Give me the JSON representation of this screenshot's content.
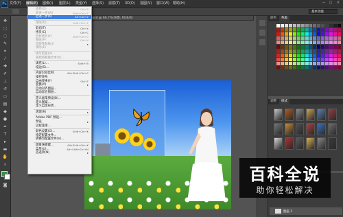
{
  "app": {
    "logo": "Ps"
  },
  "menubar": {
    "items": [
      {
        "label": "文件(F)"
      },
      {
        "label": "编辑(E)"
      },
      {
        "label": "图像(I)"
      },
      {
        "label": "图层(L)"
      },
      {
        "label": "类型(Y)"
      },
      {
        "label": "选择(S)"
      },
      {
        "label": "滤镜(T)"
      },
      {
        "label": "3D(D)"
      },
      {
        "label": "视图(V)"
      },
      {
        "label": "窗口(W)"
      },
      {
        "label": "帮助(H)"
      }
    ],
    "window_controls": [
      "—",
      "□",
      "×"
    ]
  },
  "options_bar": {
    "workspace": "基本功能"
  },
  "document": {
    "tab_title": "背景.psd @ 66.7%(背景, RGB/8)"
  },
  "edit_menu": {
    "items": [
      {
        "label": "还原(O)",
        "shortcut": "Ctrl+Z",
        "disabled": true
      },
      {
        "label": "前进一步(W)",
        "shortcut": "Shift+Ctrl+Z",
        "disabled": true
      },
      {
        "label": "后退一步(K)",
        "shortcut": "Alt+Ctrl+Z",
        "highlighted": true
      },
      {
        "sep": true
      },
      {
        "label": "渐隐(D)...",
        "shortcut": "Shift+Ctrl+F",
        "disabled": true
      },
      {
        "sep": true
      },
      {
        "label": "剪切(T)",
        "shortcut": "Ctrl+X"
      },
      {
        "label": "拷贝(C)",
        "shortcut": "Ctrl+C"
      },
      {
        "label": "合并拷贝(Y)",
        "shortcut": "Shift+Ctrl+C",
        "disabled": true
      },
      {
        "label": "粘贴(P)",
        "shortcut": "Ctrl+V",
        "disabled": true
      },
      {
        "label": "选择性粘贴(I)",
        "submenu": true,
        "disabled": true
      },
      {
        "label": "清除(E)",
        "disabled": true
      },
      {
        "sep": true
      },
      {
        "label": "拼写检查(H)...",
        "disabled": true
      },
      {
        "label": "查找和替换文本(X)...",
        "disabled": true
      },
      {
        "sep": true
      },
      {
        "label": "填充(L)...",
        "shortcut": "Shift+F5"
      },
      {
        "label": "描边(S)..."
      },
      {
        "sep": true
      },
      {
        "label": "内容识别比例",
        "shortcut": "Alt+Shift+Ctrl+C"
      },
      {
        "label": "操控变形"
      },
      {
        "label": "自由变换(F)",
        "shortcut": "Ctrl+T"
      },
      {
        "label": "变换(A)",
        "submenu": true
      },
      {
        "label": "自动对齐图层..."
      },
      {
        "label": "自动混合图层..."
      },
      {
        "sep": true
      },
      {
        "label": "定义画笔预设(B)..."
      },
      {
        "label": "定义图案..."
      },
      {
        "label": "定义自定形状..."
      },
      {
        "sep": true
      },
      {
        "label": "清理(R)",
        "submenu": true
      },
      {
        "sep": true
      },
      {
        "label": "Adobe PDF 预设..."
      },
      {
        "label": "预设",
        "submenu": true
      },
      {
        "label": "远程连接..."
      },
      {
        "sep": true
      },
      {
        "label": "颜色设置(G)...",
        "shortcut": "Shift+Ctrl+K"
      },
      {
        "label": "指定配置文件..."
      },
      {
        "label": "转换为配置文件(V)..."
      },
      {
        "sep": true
      },
      {
        "label": "键盘快捷键...",
        "shortcut": "Alt+Shift+Ctrl+K"
      },
      {
        "label": "菜单(U)...",
        "shortcut": "Alt+Shift+Ctrl+M"
      },
      {
        "label": "首选项(N)",
        "submenu": true
      }
    ]
  },
  "color_panel": {
    "tabs": [
      "颜色",
      "色板"
    ],
    "active": 1
  },
  "style_panel": {
    "tabs": [
      "调整",
      "样式"
    ],
    "active": 1
  },
  "layers_panel": {
    "layer_name": "图层 1"
  },
  "watermark": {
    "title": "百科全说",
    "subtitle": "助你轻松解决"
  },
  "colors": {
    "ui_dark": "#323232",
    "panel": "#3c3c3c",
    "menu_highlight": "#3d7ee0",
    "menu_bg": "#f0f0f0"
  }
}
